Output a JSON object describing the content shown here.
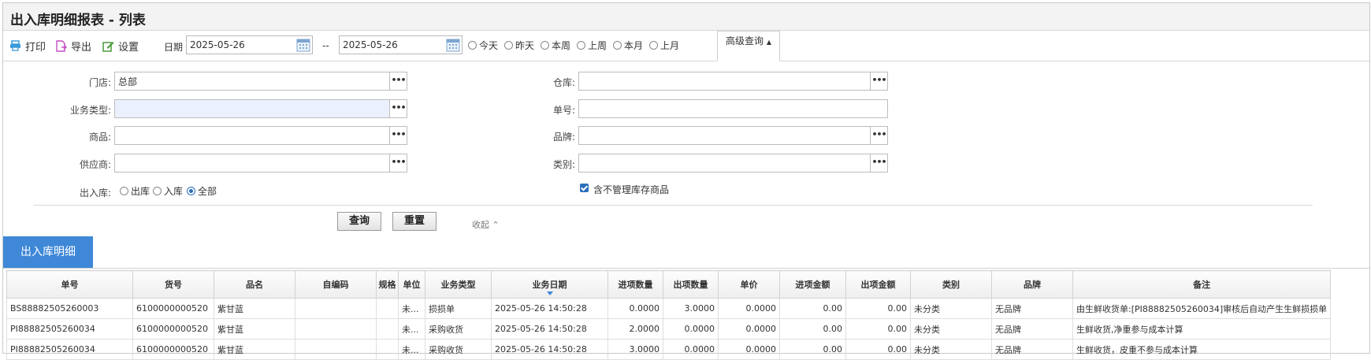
{
  "title": "出入库明细报表 - 列表",
  "toolbar": {
    "print": "打印",
    "export": "导出",
    "settings": "设置",
    "date_label": "日期",
    "date_from": "2025-05-26",
    "date_sep": "--",
    "date_to": "2025-05-26",
    "ranges": [
      "今天",
      "昨天",
      "本周",
      "上周",
      "本月",
      "上月"
    ],
    "advanced": "高级查询"
  },
  "form": {
    "store_label": "门店:",
    "store_value": "总部",
    "biztype_label": "业务类型:",
    "product_label": "商品:",
    "supplier_label": "供应商:",
    "inout_label": "出入库:",
    "inout_options": [
      "出库",
      "入库",
      "全部"
    ],
    "inout_selected": "全部",
    "warehouse_label": "仓库:",
    "docno_label": "单号:",
    "brand_label": "品牌:",
    "category_label": "类别:",
    "include_nonstock": "含不管理库存商品",
    "include_nonstock_checked": true,
    "query": "查询",
    "reset": "重置",
    "collapse": "收起"
  },
  "grid": {
    "tab": "出入库明细",
    "columns": [
      "单号",
      "货号",
      "品名",
      "自编码",
      "规格",
      "单位",
      "业务类型",
      "业务日期",
      "进项数量",
      "出项数量",
      "单价",
      "进项金额",
      "出项金额",
      "类别",
      "品牌",
      "备注"
    ],
    "rows": [
      [
        "BS88882505260003",
        "6100000000520",
        "紫甘蓝",
        "",
        "",
        "未...",
        "损损单",
        "2025-05-26 14:50:28",
        "0.0000",
        "3.0000",
        "0.0000",
        "0.00",
        "0.00",
        "未分类",
        "无品牌",
        "由生鲜收货单:[PI88882505260034]审核后自动产生生鲜损损单"
      ],
      [
        "PI88882505260034",
        "6100000000520",
        "紫甘蓝",
        "",
        "",
        "未...",
        "采购收货",
        "2025-05-26 14:50:28",
        "2.0000",
        "0.0000",
        "0.0000",
        "0.00",
        "0.00",
        "未分类",
        "无品牌",
        "生鲜收货,净重参与成本计算"
      ],
      [
        "PI88882505260034",
        "6100000000520",
        "紫甘蓝",
        "",
        "",
        "未...",
        "采购收货",
        "2025-05-26 14:50:28",
        "3.0000",
        "0.0000",
        "0.0000",
        "0.00",
        "0.00",
        "未分类",
        "无品牌",
        "生鲜收货，皮重不参与成本计算"
      ]
    ]
  }
}
